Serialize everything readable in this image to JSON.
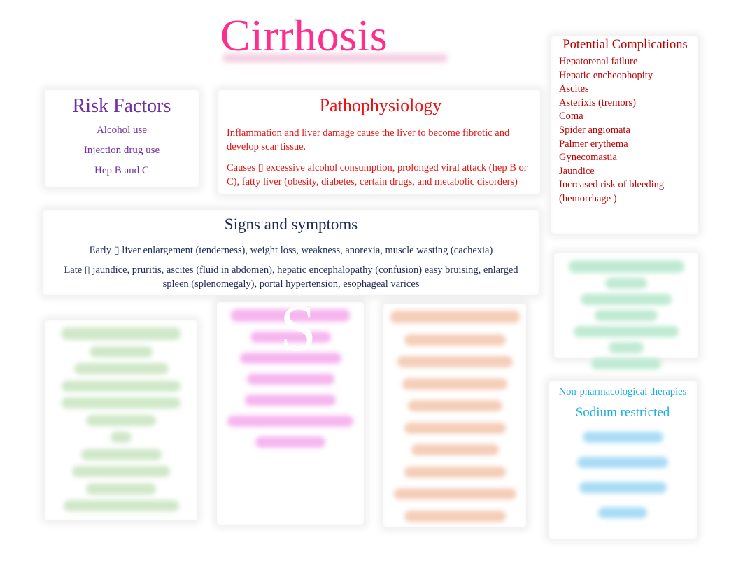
{
  "title": "Cirrhosis",
  "risk_factors": {
    "heading": "Risk Factors",
    "items": [
      "Alcohol use",
      "Injection drug use",
      "Hep B and C"
    ]
  },
  "pathophysiology": {
    "heading": "Pathophysiology",
    "description": "Inflammation and liver damage cause the liver to become fibrotic and develop scar tissue.",
    "causes": "Causes ▯   excessive alcohol consumption, prolonged viral attack (hep B or C), fatty liver (obesity, diabetes, certain drugs, and metabolic disorders)"
  },
  "complications": {
    "heading": "Potential Complications",
    "items": [
      "Hepatorenal failure",
      "Hepatic encheophopity",
      "Ascites",
      "Asterixis (tremors)",
      "Coma",
      "Spider angiomata",
      "Palmer erythema",
      "Gynecomastia",
      "Jaundice",
      "Increased risk of bleeding",
      "(hemorrhage )"
    ]
  },
  "signs": {
    "heading": "Signs and symptoms",
    "early": "Early ▯  liver enlargement (tenderness), weight loss, weakness, anorexia, muscle wasting (cachexia)",
    "late": "Late ▯   jaundice, pruritis, ascites (fluid in abdomen), hepatic encephalopathy (confusion) easy bruising, enlarged spleen (splenomegaly), portal hypertension, esophageal varices"
  },
  "overlay_letter": "S",
  "nonpharm": {
    "heading": "Non-pharmacological therapies",
    "first_item": "Sodium restricted"
  },
  "colors": {
    "title": "#ff2d8c",
    "risk": "#7030a0",
    "patho": "#ee1111",
    "complications": "#c00000",
    "signs": "#1f2a5a",
    "nonpharm": "#1eaee6"
  }
}
